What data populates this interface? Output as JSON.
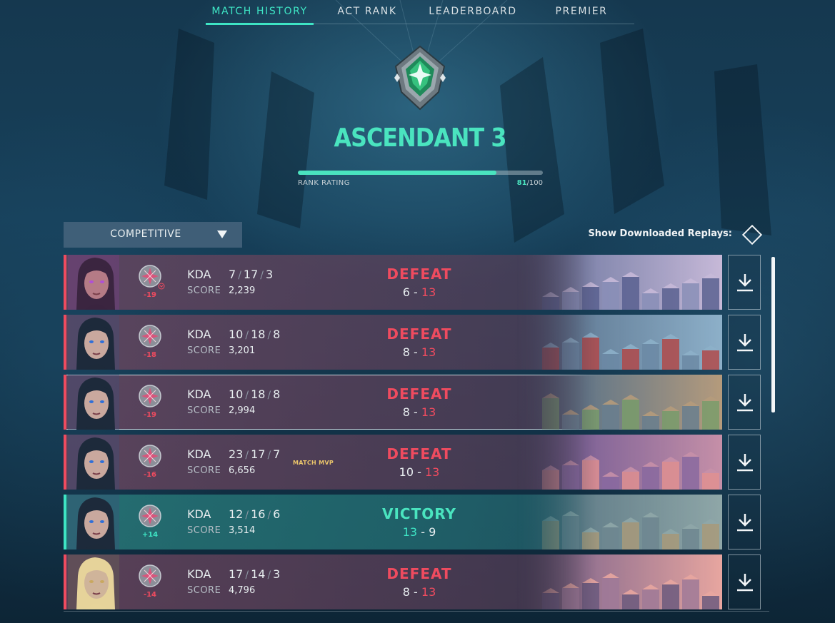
{
  "tabs": [
    {
      "label": "MATCH HISTORY",
      "active": true
    },
    {
      "label": "ACT RANK",
      "active": false
    },
    {
      "label": "LEADERBOARD",
      "active": false
    },
    {
      "label": "PREMIER",
      "active": false
    }
  ],
  "rank": {
    "name": "ASCENDANT 3",
    "rating_label": "RANK RATING",
    "rating_current": "81",
    "rating_max": "/100",
    "rating_fraction": 0.81,
    "icon": "ascendant-rank-icon",
    "accent_color": "#4ae4bf"
  },
  "filter": {
    "mode": "COMPETITIVE",
    "show_replays_label": "Show Downloaded Replays:"
  },
  "colors": {
    "defeat": "#ef4b5f",
    "victory": "#3ee4c4",
    "mvp": "#e9c46a"
  },
  "matches": [
    {
      "agent": "Reyna",
      "rr_change": "-19",
      "kda_label": "KDA",
      "k": "7",
      "d": "17",
      "a": "3",
      "score_label": "SCORE",
      "score": "2,239",
      "result": "DEFEAT",
      "team_score": "6",
      "enemy_score": "13",
      "sep": "-",
      "mvp": ""
    },
    {
      "agent": "Neon",
      "rr_change": "-18",
      "kda_label": "KDA",
      "k": "10",
      "d": "18",
      "a": "8",
      "score_label": "SCORE",
      "score": "3,201",
      "result": "DEFEAT",
      "team_score": "8",
      "enemy_score": "13",
      "sep": "-",
      "mvp": ""
    },
    {
      "agent": "Neon",
      "rr_change": "-19",
      "kda_label": "KDA",
      "k": "10",
      "d": "18",
      "a": "8",
      "score_label": "SCORE",
      "score": "2,994",
      "result": "DEFEAT",
      "team_score": "8",
      "enemy_score": "13",
      "sep": "-",
      "mvp": ""
    },
    {
      "agent": "Neon",
      "rr_change": "-16",
      "kda_label": "KDA",
      "k": "23",
      "d": "17",
      "a": "7",
      "score_label": "SCORE",
      "score": "6,656",
      "result": "DEFEAT",
      "team_score": "10",
      "enemy_score": "13",
      "sep": "-",
      "mvp": "MATCH MVP"
    },
    {
      "agent": "Neon",
      "rr_change": "+14",
      "kda_label": "KDA",
      "k": "12",
      "d": "16",
      "a": "6",
      "score_label": "SCORE",
      "score": "3,514",
      "result": "VICTORY",
      "team_score": "13",
      "enemy_score": "9",
      "sep": "-",
      "mvp": ""
    },
    {
      "agent": "Chamber",
      "rr_change": "-14",
      "kda_label": "KDA",
      "k": "17",
      "d": "14",
      "a": "3",
      "score_label": "SCORE",
      "score": "4,796",
      "result": "DEFEAT",
      "team_score": "8",
      "enemy_score": "13",
      "sep": "-",
      "mvp": ""
    }
  ]
}
